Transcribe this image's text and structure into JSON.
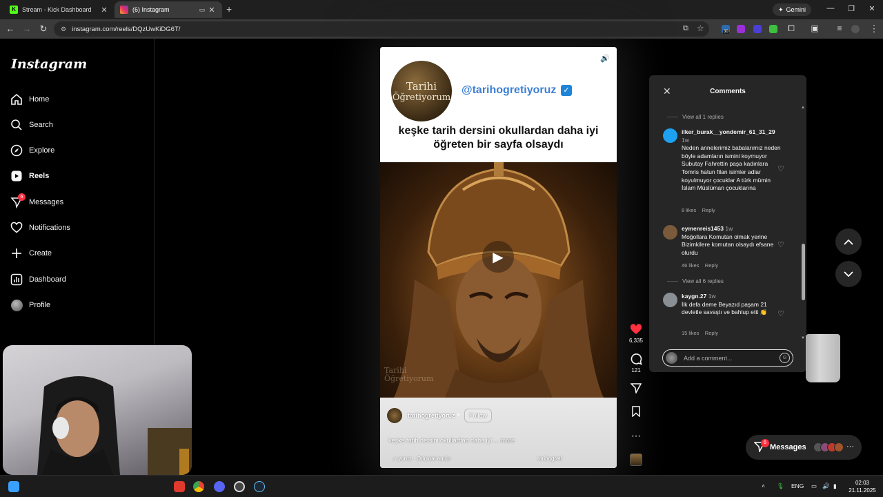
{
  "browser": {
    "tabs": [
      {
        "title": "Stream - Kick Dashboard",
        "favicon_color": "#53fc18"
      },
      {
        "title": "(6) Instagram",
        "favicon_color": "#e1306c"
      }
    ],
    "new_tab": "+",
    "gemini_label": "Gemini",
    "url": "instagram.com/reels/DQzUwKiDG6T/",
    "extension_badge": "30"
  },
  "sidebar": {
    "logo": "Instagram",
    "items": [
      {
        "label": "Home",
        "icon": "home-icon"
      },
      {
        "label": "Search",
        "icon": "search-icon"
      },
      {
        "label": "Explore",
        "icon": "compass-icon"
      },
      {
        "label": "Reels",
        "icon": "reels-icon"
      },
      {
        "label": "Messages",
        "icon": "messenger-icon",
        "badge": "6"
      },
      {
        "label": "Notifications",
        "icon": "heart-icon"
      },
      {
        "label": "Create",
        "icon": "plus-icon"
      },
      {
        "label": "Dashboard",
        "icon": "dashboard-icon"
      },
      {
        "label": "Profile",
        "icon": "avatar"
      }
    ]
  },
  "reel": {
    "logo_line1": "Tarihi",
    "logo_line2": "Öğretiyorum",
    "handle": "@tarihogretiyoruz",
    "headline_line1": "keşke tarih dersini okullardan daha iyi",
    "headline_line2": "öğreten bir sayfa olsaydı",
    "watermark_line1": "Tarihi",
    "watermark_line2": "Öğretiyorum",
    "username": "tarihogretiyoruz",
    "separator": "•",
    "follow_label": "Follow",
    "caption": "keşke tarih dersini okullardan daha iyi ...",
    "more_label": "more",
    "audio": "yoruz · Original audio",
    "audio_tag": "tarihogreti"
  },
  "actions": {
    "likes": "6,335",
    "comments": "121"
  },
  "comments_panel": {
    "title": "Comments",
    "view_replies_1": "View all 1 replies",
    "view_replies_2": "View all 6 replies",
    "items": [
      {
        "user": "ilker_burak__yondemir_61_31_29",
        "time": "1w",
        "text": "Neden annelerimiz babalarımız neden böyle adamların ismini koymuyor Subutay Fahrettin paşa kadınlara Tomris hatun filan isimler adlar koyulmuyor çocuklar A türk mümin İslam Müslüman çocuklarına",
        "likes": "8 likes",
        "reply": "Reply",
        "avatar_color": "#1da1f2"
      },
      {
        "user": "eymenreis1453",
        "time": "1w",
        "text": "Moğollara Komutan olmak yerine Bizimkilere komutan olsaydı efsane olurdu",
        "likes": "46 likes",
        "reply": "Reply",
        "avatar_color": "#7a5a3a"
      },
      {
        "user": "kaygn.27",
        "time": "1w",
        "text": "İlk defa deme Beyazıd paşam 21 devletle savaştı ve bahlup etti 👏",
        "likes": "15 likes",
        "reply": "Reply",
        "avatar_color": "#8a8f95"
      }
    ],
    "input_placeholder": "Add a comment..."
  },
  "messages_pill": {
    "label": "Messages",
    "badge": "6"
  },
  "taskbar": {
    "lang": "ENG",
    "time": "02:03",
    "date": "21.11.2025"
  }
}
